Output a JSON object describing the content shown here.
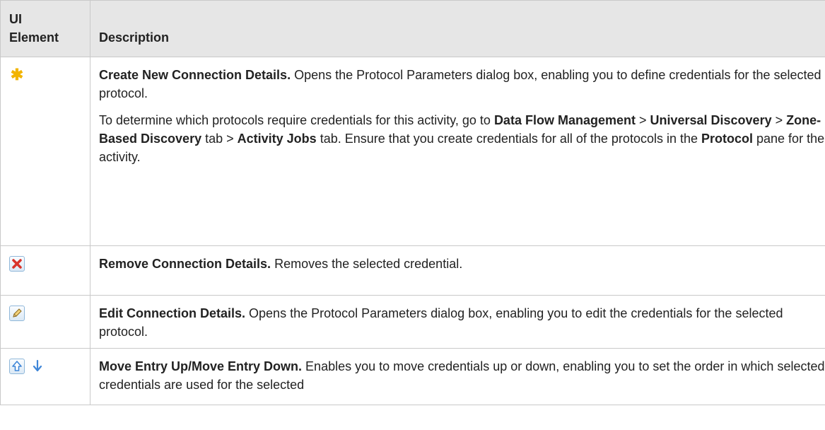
{
  "header": {
    "col1": "UI\nElement",
    "col1_line1": "UI",
    "col1_line2": "Element",
    "col2": "Description"
  },
  "rows": [
    {
      "icon": "new-connection-icon",
      "title": "Create New Connection Details.",
      "text": " Opens the Protocol Parameters dialog box, enabling you to define credentials for the selected protocol.",
      "p2": {
        "t1": "To determine which protocols require credentials for this activity, go to ",
        "b1": "Data Flow Management",
        "t2": " > ",
        "b2": "Universal Discovery",
        "t3": " > ",
        "b3": "Zone-Based Discovery",
        "t4": " tab > ",
        "b4": "Activity Jobs",
        "t5": " tab. Ensure that you create credentials for all of the protocols in the ",
        "b5": "Protocol",
        "t6": " pane for the activity."
      }
    },
    {
      "icon": "remove-icon",
      "title": "Remove Connection Details.",
      "text": " Removes the selected credential."
    },
    {
      "icon": "edit-pencil-icon",
      "title": "Edit Connection Details.",
      "text": " Opens the Protocol Parameters dialog box, enabling you to edit the credentials for the selected protocol."
    },
    {
      "icon": "move-up-down-icons",
      "title": "Move Entry Up/Move Entry Down.",
      "text": " Enables you to move credentials up or down, enabling you to set the order in which selected credentials are used for the selected"
    }
  ],
  "colors": {
    "header_bg": "#e6e6e6",
    "border": "#c9c9c9",
    "new_icon": "#f2b400",
    "remove_icon": "#d9342b",
    "arrow_icon": "#3f86d8"
  }
}
